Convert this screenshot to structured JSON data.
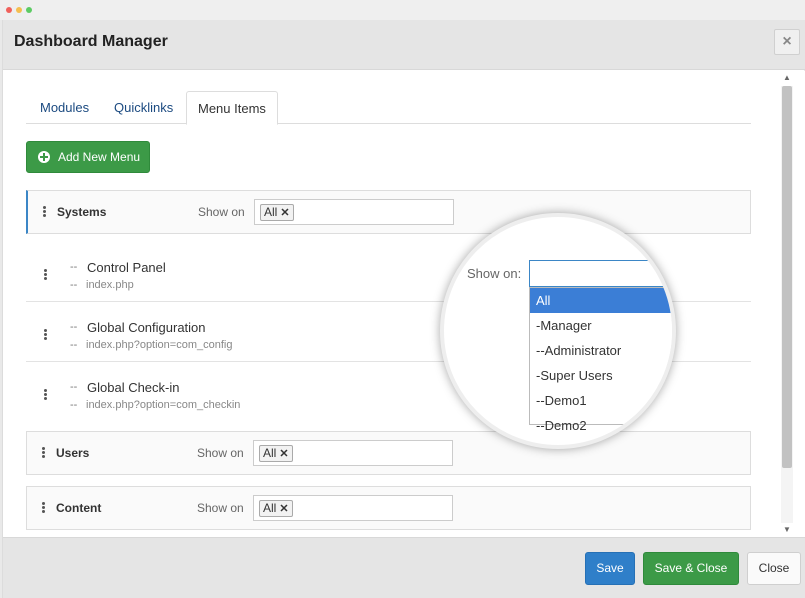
{
  "window": {
    "title": "Dashboard Manager",
    "close_label": "×"
  },
  "tabs": [
    {
      "label": "Modules"
    },
    {
      "label": "Quicklinks"
    },
    {
      "label": "Menu Items"
    }
  ],
  "add_button": {
    "label": "Add New Menu"
  },
  "show_on_label": "Show on",
  "tag_remove_glyph": "✕",
  "groups": [
    {
      "title": "Systems",
      "tag": "All"
    },
    {
      "title": "Users",
      "tag": "All"
    },
    {
      "title": "Content",
      "tag": "All"
    }
  ],
  "items": [
    {
      "prefix": "--",
      "title": "Control Panel",
      "link_prefix": "--",
      "link": "index.php"
    },
    {
      "prefix": "--",
      "title": "Global Configuration",
      "link_prefix": "--",
      "link": "index.php?option=com_config"
    },
    {
      "prefix": "--",
      "title": "Global Check-in",
      "link_prefix": "--",
      "link": "index.php?option=com_checkin"
    }
  ],
  "magnifier": {
    "show_on_label": "Show on:",
    "options": [
      "All",
      "-Manager",
      "--Administrator",
      "-Super Users",
      "--Demo1",
      "--Demo2"
    ],
    "selected": "All"
  },
  "footer": {
    "save": "Save",
    "save_close": "Save & Close",
    "close": "Close"
  },
  "colors": {
    "primary": "#2f7fc9",
    "success": "#3c9a47",
    "highlight": "#3b7ed6"
  }
}
